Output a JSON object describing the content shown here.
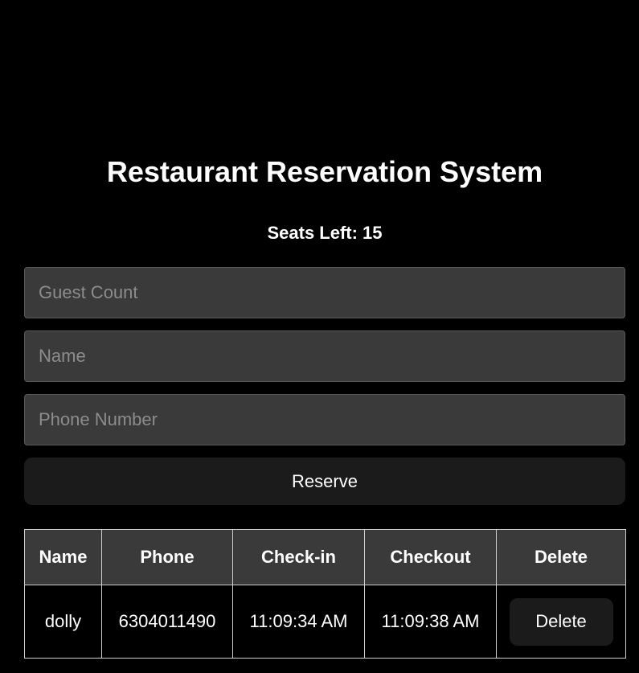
{
  "app": {
    "title": "Restaurant Reservation System",
    "seats_label": "Seats Left: 15"
  },
  "form": {
    "guest_count": {
      "placeholder": "Guest Count",
      "value": ""
    },
    "name": {
      "placeholder": "Name",
      "value": ""
    },
    "phone": {
      "placeholder": "Phone Number",
      "value": ""
    },
    "reserve_label": "Reserve"
  },
  "table": {
    "headers": [
      "Name",
      "Phone",
      "Check-in",
      "Checkout",
      "Delete"
    ],
    "rows": [
      {
        "name": "dolly",
        "phone": "6304011490",
        "checkin": "11:09:34 AM",
        "checkout": "11:09:38 AM",
        "delete_label": "Delete"
      }
    ]
  },
  "colors": {
    "background": "#000000",
    "input_bg": "#3a3a3a",
    "button_bg": "#1b1b1b",
    "header_bg": "#3a3a3a",
    "border": "#cfcfcf",
    "text": "#ffffff"
  }
}
